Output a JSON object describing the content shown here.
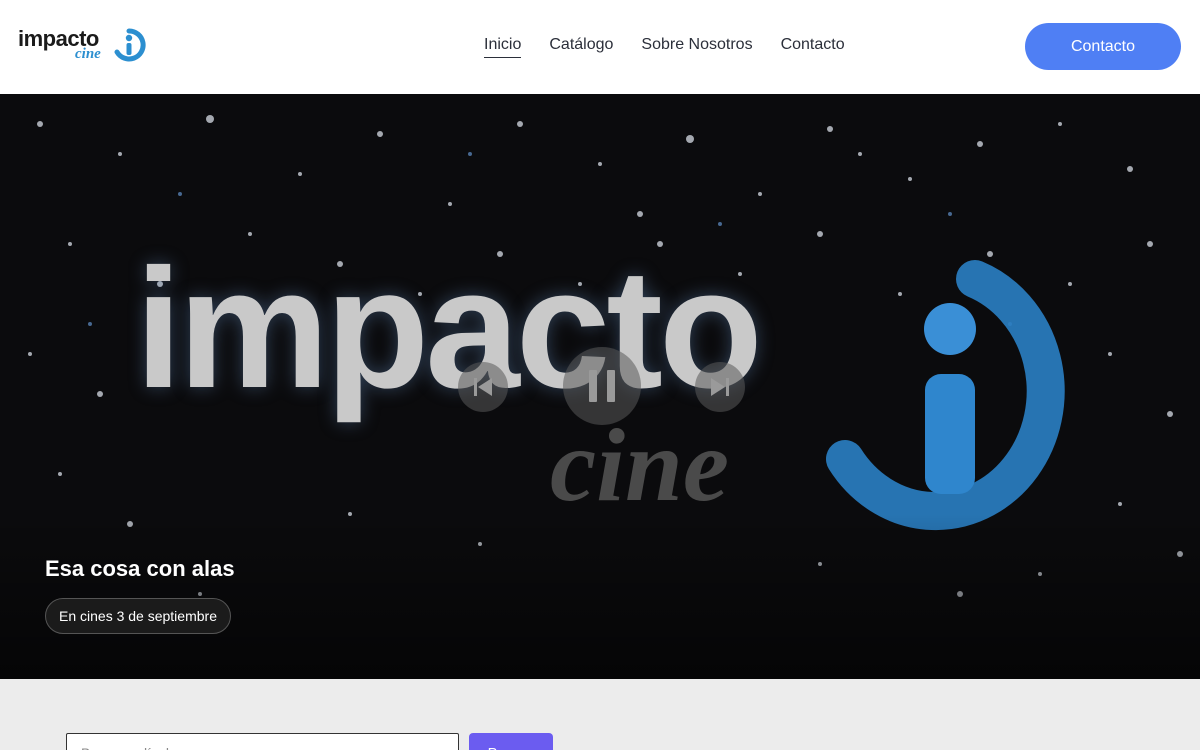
{
  "brand": {
    "name": "impacto",
    "subname": "cine",
    "logo_icon": "impacto-i-logo-icon",
    "accent_color": "#2c8fd0"
  },
  "nav": {
    "items": [
      {
        "label": "Inicio",
        "active": true
      },
      {
        "label": "Catálogo",
        "active": false
      },
      {
        "label": "Sobre Nosotros",
        "active": false
      },
      {
        "label": "Contacto",
        "active": false
      }
    ],
    "cta_label": "Contacto",
    "cta_color": "#4f7ff4"
  },
  "hero": {
    "video_word": "impacto",
    "video_subword": "cine",
    "title": "Esa cosa con alas",
    "badge": "En cines 3 de septiembre",
    "controls": {
      "prev_icon": "skip-previous-icon",
      "pause_icon": "pause-icon",
      "next_icon": "skip-next-icon"
    }
  },
  "search": {
    "placeholder": "Buscar película...",
    "button_label": "Buscar",
    "button_color": "#6b5cf0"
  }
}
